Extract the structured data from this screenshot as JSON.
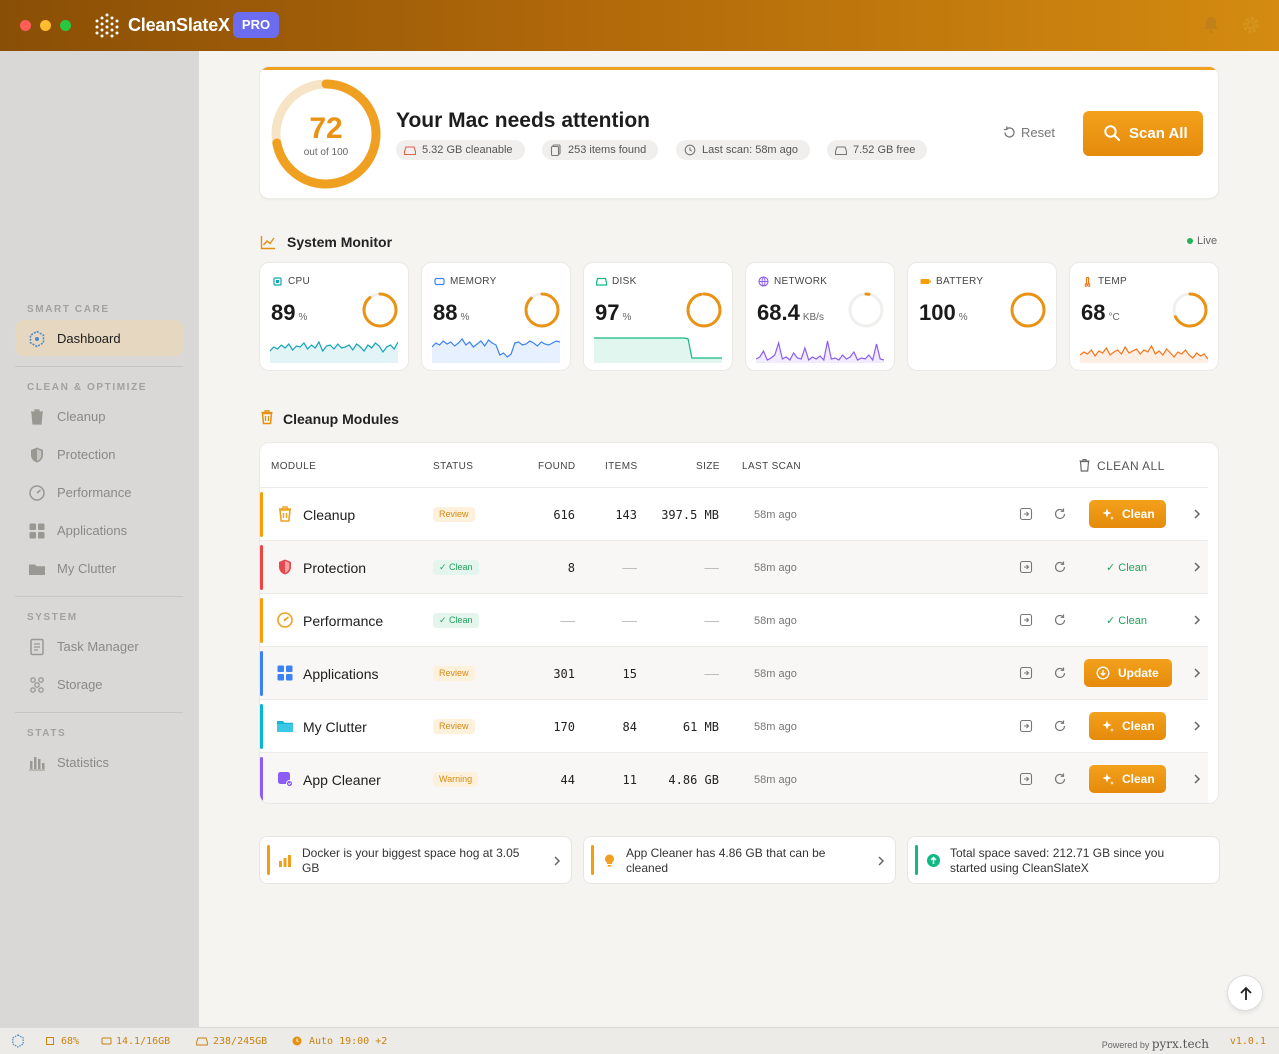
{
  "app": {
    "name": "CleanSlateX",
    "badge": "PRO"
  },
  "sidebar": {
    "sections": [
      {
        "title": "SMART CARE",
        "items": [
          {
            "label": "Dashboard",
            "icon": "hexagon-logo-icon",
            "active": true
          }
        ]
      },
      {
        "title": "CLEAN & OPTIMIZE",
        "items": [
          {
            "label": "Cleanup",
            "icon": "trash-icon"
          },
          {
            "label": "Protection",
            "icon": "shield-icon"
          },
          {
            "label": "Performance",
            "icon": "gauge-icon"
          },
          {
            "label": "Applications",
            "icon": "grid-icon"
          },
          {
            "label": "My Clutter",
            "icon": "folder-icon"
          }
        ]
      },
      {
        "title": "SYSTEM",
        "items": [
          {
            "label": "Task Manager",
            "icon": "document-icon"
          },
          {
            "label": "Storage",
            "icon": "storage-icon"
          }
        ]
      },
      {
        "title": "STATS",
        "items": [
          {
            "label": "Statistics",
            "icon": "bar-chart-icon"
          }
        ]
      }
    ]
  },
  "hero": {
    "score": "72",
    "score_sub": "out of 100",
    "score_fraction": 0.72,
    "title": "Your Mac needs attention",
    "chips": [
      "5.32 GB cleanable",
      "253 items found",
      "Last scan: 58m ago",
      "7.52 GB free"
    ],
    "reset_label": "Reset",
    "scan_label": "Scan All"
  },
  "monitor": {
    "title": "System Monitor",
    "live": "Live",
    "cards": [
      {
        "label": "CPU",
        "value": "89",
        "unit": "%",
        "level": 0.89,
        "color": "#14a3b8"
      },
      {
        "label": "MEMORY",
        "value": "88",
        "unit": "%",
        "level": 0.88,
        "color": "#3b82f6"
      },
      {
        "label": "DISK",
        "value": "97",
        "unit": "%",
        "level": 0.97,
        "color": "#10b981"
      },
      {
        "label": "NETWORK",
        "value": "68.4",
        "unit": "KB/s",
        "level": 0.03,
        "color": "#8b5cf6"
      },
      {
        "label": "BATTERY",
        "value": "100",
        "unit": "%",
        "level": 1.0,
        "color": "#f59e0b"
      },
      {
        "label": "TEMP",
        "value": "68",
        "unit": "°C",
        "level": 0.68,
        "color": "#f97316"
      }
    ]
  },
  "modules": {
    "title": "Cleanup Modules",
    "headers": {
      "module": "MODULE",
      "status": "STATUS",
      "found": "FOUND",
      "items": "ITEMS",
      "size": "SIZE",
      "last_scan": "LAST SCAN",
      "clean_all": "CLEAN ALL"
    },
    "rows": [
      {
        "name": "Cleanup",
        "status": "Review",
        "found": "616",
        "items": "143",
        "size": "397.5 MB",
        "last_scan": "58m ago",
        "action": "Clean",
        "accent": "#f59e0b"
      },
      {
        "name": "Protection",
        "status": "✓ Clean",
        "found": "8",
        "items": "——",
        "size": "——",
        "last_scan": "58m ago",
        "action": "✓ Clean",
        "accent": "#ef4444"
      },
      {
        "name": "Performance",
        "status": "✓ Clean",
        "found": "——",
        "items": "——",
        "size": "——",
        "last_scan": "58m ago",
        "action": "✓ Clean",
        "accent": "#f59e0b"
      },
      {
        "name": "Applications",
        "status": "Review",
        "found": "301",
        "items": "15",
        "size": "——",
        "last_scan": "58m ago",
        "action": "Update",
        "accent": "#3b82f6"
      },
      {
        "name": "My Clutter",
        "status": "Review",
        "found": "170",
        "items": "84",
        "size": "61 MB",
        "last_scan": "58m ago",
        "action": "Clean",
        "accent": "#06b6d4"
      },
      {
        "name": "App Cleaner",
        "status": "Warning",
        "found": "44",
        "items": "11",
        "size": "4.86 GB",
        "last_scan": "58m ago",
        "action": "Clean",
        "accent": "#8b5cf6"
      }
    ]
  },
  "insights": [
    {
      "text": "Docker is your biggest space hog at 3.05 GB",
      "accent": "#f59e0b"
    },
    {
      "text": "App Cleaner has 4.86 GB that can be cleaned",
      "accent": "#f59e0b"
    },
    {
      "text": "Total space saved: 212.71 GB since you started using CleanSlateX",
      "accent": "#10b981"
    }
  ],
  "statusbar": {
    "cpu": "68%",
    "memory": "14.1/16GB",
    "disk": "238/245GB",
    "auto": "Auto 19:00 +2",
    "powered_by": "Powered by",
    "brand": "pyrx.tech",
    "version": "v1.0.1"
  }
}
